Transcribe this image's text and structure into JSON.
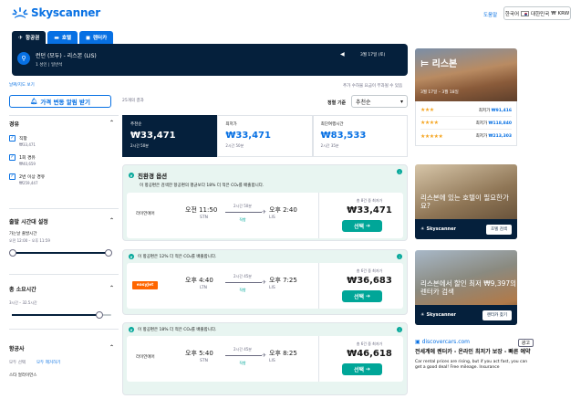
{
  "header": {
    "logo_text": "Skyscanner",
    "help": "도움말",
    "region": "한국어",
    "country": "대한민국",
    "currency": "₩ KRW"
  },
  "tabs": [
    {
      "label": "항공권",
      "icon": "plane-icon"
    },
    {
      "label": "호텔",
      "icon": "bed-icon"
    },
    {
      "label": "렌터카",
      "icon": "car-icon"
    }
  ],
  "search": {
    "route": "런던 (모두) - 리스본 (LIS)",
    "sub": "1 성인 | 일반석",
    "date": "3월 17일 (토)"
  },
  "filters": {
    "map_link": "날짜/지도 보기",
    "alert_button": "가격 변동 알림 받기",
    "stops_title": "경유",
    "stops": [
      {
        "label": "직항",
        "price": "₩33,471"
      },
      {
        "label": "1회 경유",
        "price": "₩40,659"
      },
      {
        "label": "2번 이상 경유",
        "price": "₩259,447"
      }
    ],
    "departure_title": "출발 시간대 설정",
    "outbound_label": "가는날 출발시간",
    "outbound_range": "오전 12:00 – 오후 11:59",
    "duration_title": "총 소요시간",
    "duration_range": "3시간 – 32.5시간",
    "duration_level": 0.9,
    "airlines_title": "항공사",
    "airlines_select_all": "모두 선택",
    "airlines_clear_all": "모두 제거하기",
    "airline_first": "스타 얼라이언스"
  },
  "results": {
    "count": "25개의 결과",
    "extra": "추가 수하물 요금이 부과될 수 있음",
    "sort_label": "정렬 기준",
    "sort_value": "추천순",
    "price_tabs": [
      {
        "name": "추천순",
        "price": "₩33,471",
        "dur": "2시간 50분"
      },
      {
        "name": "최저가",
        "price": "₩33,471",
        "dur": "2시간 50분"
      },
      {
        "name": "최단여행시간",
        "price": "₩83,533",
        "dur": "2시간 35분"
      }
    ],
    "eco_title": "친환경 옵션",
    "eco_subtitle": "이 항공편은 검색한 항공편의 평균보다 18% 더 적은 CO₂를 배출합니다.",
    "cards": [
      {
        "eco_note": "",
        "airline": "라이언에어",
        "dep_time": "오전 11:50",
        "dep_code": "STN",
        "duration": "2시간 50분",
        "direct": "직항",
        "arr_time": "오후 2:40",
        "arr_code": "LIS",
        "deals": "총 8건 중 최저가",
        "price": "₩33,471",
        "select": "선택"
      },
      {
        "eco_note": "이 항공편은 12% 더 적은 CO₂를 배출합니다.",
        "airline": "easyJet",
        "dep_time": "오후 4:40",
        "dep_code": "LTN",
        "duration": "2시간 45분",
        "direct": "직항",
        "arr_time": "오후 7:25",
        "arr_code": "LIS",
        "deals": "총 6건 중 최저가",
        "price": "₩36,683",
        "select": "선택"
      },
      {
        "eco_note": "이 항공편은 18% 더 적은 CO₂를 배출합니다.",
        "airline": "라이언에어",
        "dep_time": "오후 5:40",
        "dep_code": "STN",
        "duration": "2시간 45분",
        "direct": "직항",
        "arr_time": "오후 8:25",
        "arr_code": "LIS",
        "deals": "총 6건 중 최저가",
        "price": "₩46,618",
        "select": "선택"
      }
    ]
  },
  "sidebar": {
    "hotel_promo_title": "리스본",
    "hotel_promo_date": "3월 17일 – 3월 18일",
    "hotels": [
      {
        "stars": "★★★",
        "price_label": "최저가",
        "price": "₩91,416"
      },
      {
        "stars": "★★★★",
        "price_label": "최저가",
        "price": "₩118,840"
      },
      {
        "stars": "★★★★★",
        "price_label": "최저가",
        "price": "₩213,303"
      }
    ],
    "promo2_text": "리스본에 있는 호텔이 필요한가요?",
    "promo2_brand": "Skyscanner",
    "promo2_button": "호텔 검색",
    "promo3_text": "리스본에서 할인 최저 ₩9,397의 렌터카 검색",
    "promo3_brand": "Skyscanner",
    "promo3_button": "렌터카 찾기",
    "ad_domain": "discovercars.com",
    "ad_badge": "광고",
    "ad_title": "전세계에 렌터카 - 온라인 최저가 보장 - 빠른 예약",
    "ad_body": "Car rental prices are rising, but if you act fast, you can get a good deal! Free mileage. Insurance"
  }
}
